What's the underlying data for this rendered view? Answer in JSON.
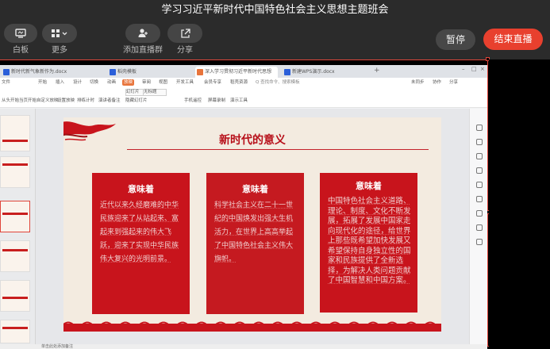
{
  "live": {
    "title": "学习习近平新时代中国特色社会主义思想主题班会",
    "tools": [
      {
        "name": "whiteboard",
        "label": "白板"
      },
      {
        "name": "more",
        "label": "更多"
      },
      {
        "name": "add-live-group",
        "label": "添加直播群"
      },
      {
        "name": "share",
        "label": "分享"
      }
    ],
    "pause_label": "暂停",
    "end_label": "结束直播",
    "end_color": "#e8402e"
  },
  "app": {
    "tabs": [
      {
        "label": "新时代新气象新作为.docx",
        "color": "#2b5fd9"
      },
      {
        "label": "稻壳模板",
        "color": "#2b5fd9"
      },
      {
        "label": "深入学习贯彻习近平新时代思想",
        "color": "#e8743b"
      },
      {
        "label": "新建WPS演示.docx",
        "color": "#2b5fd9"
      }
    ],
    "menu": [
      "文件",
      "开始",
      "插入",
      "设计",
      "切换",
      "动画",
      "放映",
      "审阅",
      "视图",
      "开发工具",
      "会员专享",
      "稻壳资源"
    ],
    "menu_active": "放映",
    "search_placeholder": "Q 查找命令、搜索模板",
    "account": [
      "未同步",
      "协作",
      "分享"
    ],
    "ribbon": [
      "从头开始",
      "当页开始",
      "自定义放映",
      "设置放映",
      "排练计时",
      "演讲者备注",
      "手机遥控",
      "屏幕录制",
      "隐藏幻灯片",
      "演示工具"
    ],
    "ribbon_selects": [
      "幻灯片",
      "无标题"
    ],
    "status_text": "单击此处添加备注"
  },
  "slide": {
    "title": "新时代的意义",
    "accent_color": "#c8141c",
    "cards": [
      {
        "heading": "意味着",
        "body": "近代以来久经磨难的中华民族迎来了从站起来、富起来到强起来的伟大飞跃，迎来了实现中华民族伟大复兴的光明前景。"
      },
      {
        "heading": "意味着",
        "body": "科学社会主义在二十一世纪的中国焕发出强大生机活力，在世界上高高举起了中国特色社会主义伟大旗帜。"
      },
      {
        "heading": "意味着",
        "body": "中国特色社会主义道路、理论、制度、文化不断发展，拓展了发展中国家走向现代化的途径，给世界上那些既希望加快发展又希望保持自身独立性的国家和民族提供了全新选择，为解决人类问题贡献了中国智慧和中国方案。"
      }
    ]
  }
}
